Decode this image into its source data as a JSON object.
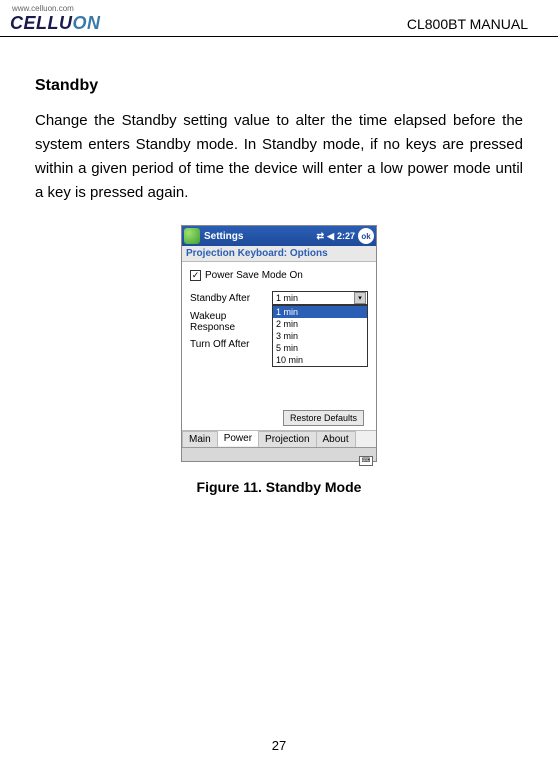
{
  "header": {
    "url": "www.celluon.com",
    "logo_main": "CELLU",
    "logo_accent": "ON",
    "manual": "CL800BT MANUAL"
  },
  "section_title": "Standby",
  "body_text": "Change the Standby setting value to alter the time elapsed before the system enters Standby mode. In Standby mode, if no keys are pressed within a given period of time the device will enter a low power mode until a key is pressed again.",
  "screenshot": {
    "titlebar": {
      "app": "Settings",
      "time": "2:27",
      "ok": "ok"
    },
    "subheader": "Projection Keyboard: Options",
    "checkbox_label": "Power Save Mode On",
    "labels": {
      "standby": "Standby After",
      "wakeup": "Wakeup Response",
      "turnoff": "Turn Off After"
    },
    "dropdown": {
      "selected": "1 min",
      "options": [
        "1 min",
        "2 min",
        "3 min",
        "5 min",
        "10 min"
      ]
    },
    "restore": "Restore Defaults",
    "tabs": [
      "Main",
      "Power",
      "Projection",
      "About"
    ]
  },
  "figure_caption": "Figure 11. Standby Mode",
  "page_number": "27"
}
